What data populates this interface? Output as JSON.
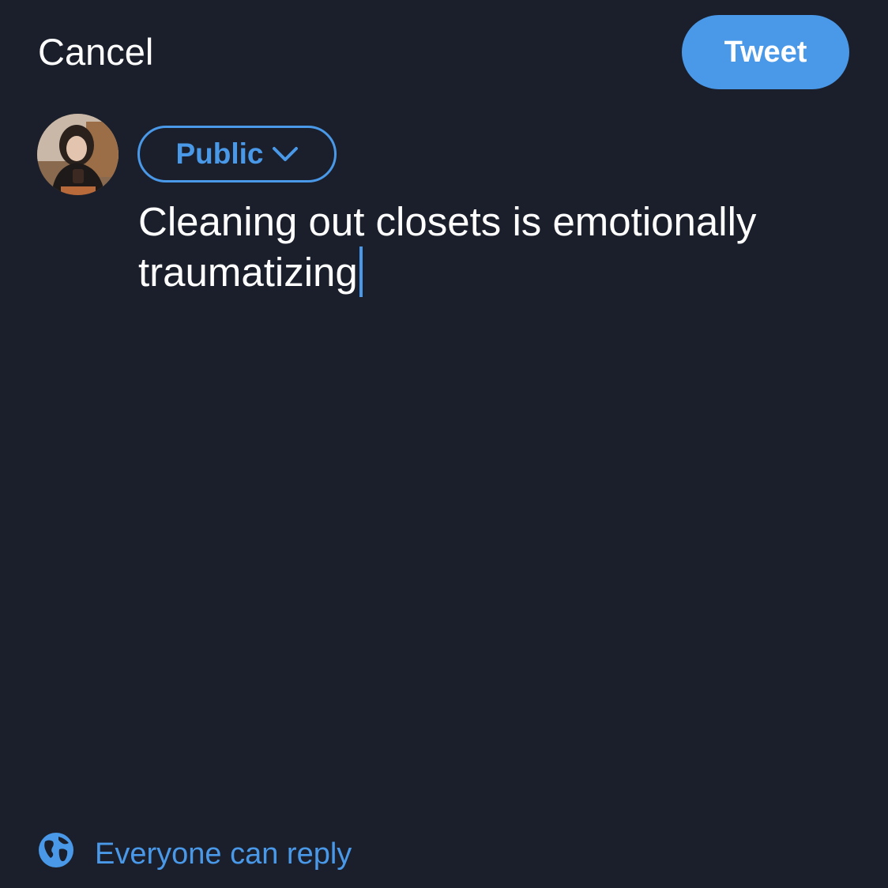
{
  "header": {
    "cancel_label": "Cancel",
    "tweet_label": "Tweet"
  },
  "audience": {
    "label": "Public"
  },
  "compose": {
    "text": "Cleaning out closets is emotionally traumatizing"
  },
  "reply_setting": {
    "label": "Everyone can reply",
    "icon": "globe-icon"
  },
  "colors": {
    "background": "#1a1f2b",
    "accent": "#4a99e9",
    "text": "#ffffff"
  }
}
